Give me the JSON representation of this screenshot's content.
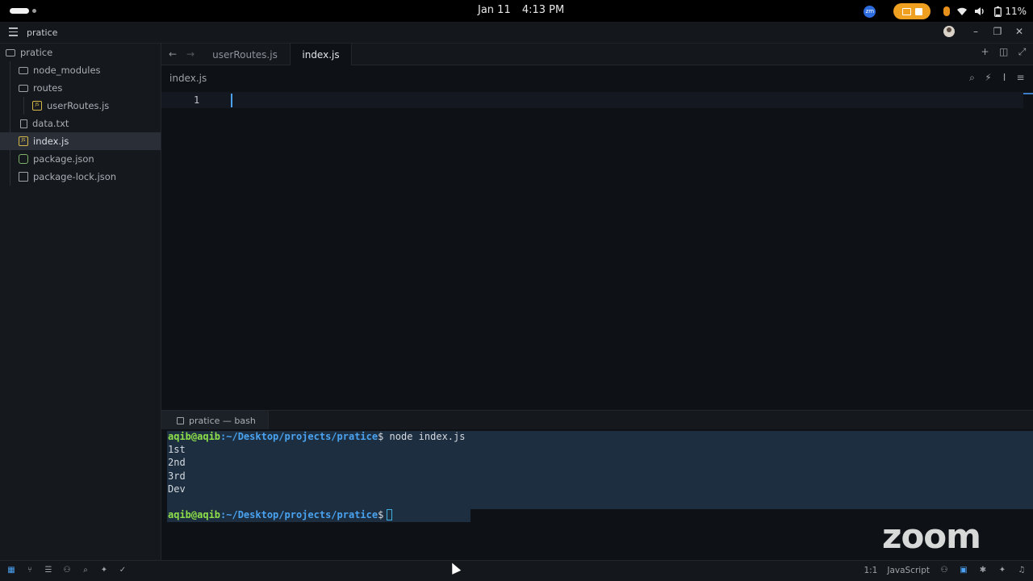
{
  "topbar": {
    "date": "Jan 11",
    "time": "4:13 PM",
    "zoom_badge": "zm",
    "battery": "11%"
  },
  "titlebar": {
    "title": "pratice"
  },
  "sidebar": {
    "root": "pratice",
    "items": [
      {
        "label": "node_modules",
        "icon": "folder-icon"
      },
      {
        "label": "routes",
        "icon": "folder-icon"
      },
      {
        "label": "userRoutes.js",
        "icon": "js-file-icon"
      },
      {
        "label": "data.txt",
        "icon": "text-file-icon"
      },
      {
        "label": "index.js",
        "icon": "js-file-icon",
        "selected": true
      },
      {
        "label": "package.json",
        "icon": "package-icon"
      },
      {
        "label": "package-lock.json",
        "icon": "lock-file-icon"
      }
    ]
  },
  "tabs": [
    {
      "label": "userRoutes.js",
      "active": false
    },
    {
      "label": "index.js",
      "active": true
    }
  ],
  "editor": {
    "breadcrumb": "index.js",
    "line_number": "1"
  },
  "terminal": {
    "tab_label": "pratice — bash",
    "prompt_user": "aqib@aqib",
    "prompt_path": ":~/Desktop/projects/pratice",
    "command": "$ node index.js",
    "output": [
      "1st",
      "2nd",
      "3rd",
      "Dev",
      ""
    ],
    "prompt_end": "$"
  },
  "watermark": "zoom",
  "statusbar": {
    "position": "1:1",
    "language": "JavaScript"
  },
  "colors": {
    "accent": "#4ca3f5",
    "prompt_user": "#8ee04a",
    "prompt_path": "#4aa3f0",
    "screen_share_pill": "#f0a020"
  }
}
